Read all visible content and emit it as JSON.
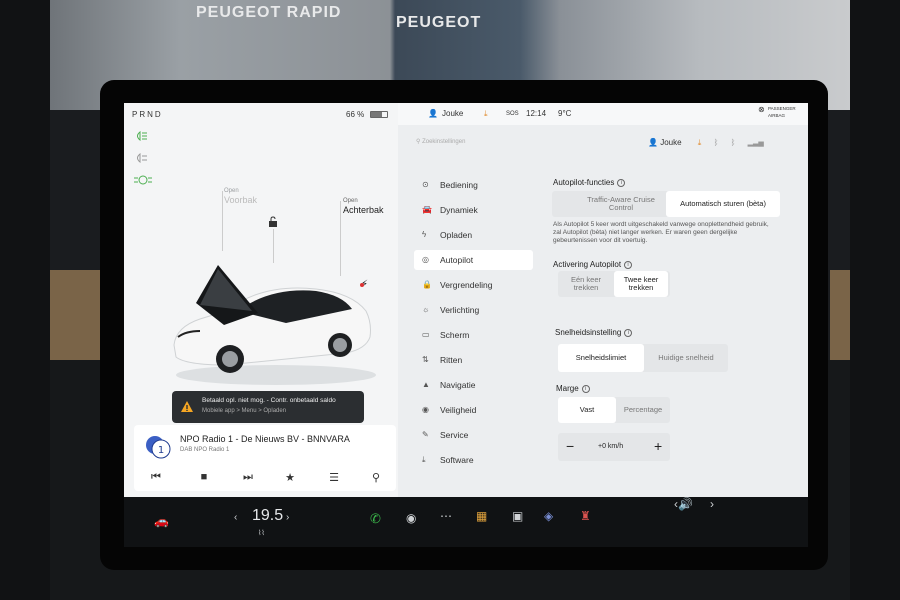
{
  "background": {
    "sign_left": "PEUGEOT RAPID",
    "sign_right": "PEUGEOT"
  },
  "left_panel": {
    "gear": "PRND",
    "battery_percent": "66 %",
    "front_trunk": {
      "state": "Open",
      "label": "Voorbak"
    },
    "rear_trunk": {
      "state": "Open",
      "label": "Achterbak"
    },
    "warning": {
      "line1": "Betaald opl. niet mog. - Contr. onbetaald saldo",
      "line2": "Mobiele app > Menu > Opladen"
    },
    "media": {
      "station_logo": "1",
      "title": "NPO Radio 1 - De Nieuws BV - BNNVARA",
      "subtitle": "DAB NPO Radio 1",
      "controls": [
        "prev-icon",
        "stop-icon",
        "next-icon",
        "favorite-icon",
        "equalizer-icon",
        "search-icon"
      ]
    }
  },
  "status_bar": {
    "user": "Jouke",
    "sos": "SOS",
    "time": "12:14",
    "outside_temp": "9°C",
    "airbag_top": "PASSENGER",
    "airbag_bottom": "AIRBAG"
  },
  "settings": {
    "search_placeholder": "Zoekinstellingen",
    "user": "Jouke",
    "menu": [
      {
        "label": "Bediening",
        "icon": "toggle-icon"
      },
      {
        "label": "Dynamiek",
        "icon": "car-icon"
      },
      {
        "label": "Opladen",
        "icon": "bolt-icon"
      },
      {
        "label": "Autopilot",
        "icon": "steering-wheel-icon",
        "selected": true
      },
      {
        "label": "Vergrendeling",
        "icon": "lock-icon"
      },
      {
        "label": "Verlichting",
        "icon": "light-icon"
      },
      {
        "label": "Scherm",
        "icon": "display-icon"
      },
      {
        "label": "Ritten",
        "icon": "trip-icon"
      },
      {
        "label": "Navigatie",
        "icon": "navigation-icon"
      },
      {
        "label": "Veiligheid",
        "icon": "shield-icon"
      },
      {
        "label": "Service",
        "icon": "wrench-icon"
      },
      {
        "label": "Software",
        "icon": "download-icon"
      }
    ],
    "autopilot_features": {
      "heading": "Autopilot-functies",
      "options": [
        "Traffic-Aware Cruise Control",
        "Automatisch sturen (bèta)"
      ],
      "selected": "Automatisch sturen (bèta)",
      "description": "Als Autopilot 5 keer wordt uitgeschakeld vanwege onoplettendheid gebruik, zal Autopilot (bèta) niet langer werken. Er waren geen dergelijke gebeurtenissen voor dit voertuig."
    },
    "activation": {
      "heading": "Activering Autopilot",
      "options": [
        "Eén keer trekken",
        "Twee keer trekken"
      ],
      "selected": "Twee keer trekken"
    },
    "speed_setting": {
      "heading": "Snelheidsinstelling",
      "options": [
        "Snelheidslimiet",
        "Huidige snelheid"
      ],
      "selected": "Snelheidslimiet"
    },
    "margin": {
      "heading": "Marge",
      "options": [
        "Vast",
        "Percentage"
      ],
      "selected": "Vast",
      "value": "+0 km/h",
      "minus": "−",
      "plus": "+"
    }
  },
  "bottom_bar": {
    "cabin_temp": "19.5"
  }
}
